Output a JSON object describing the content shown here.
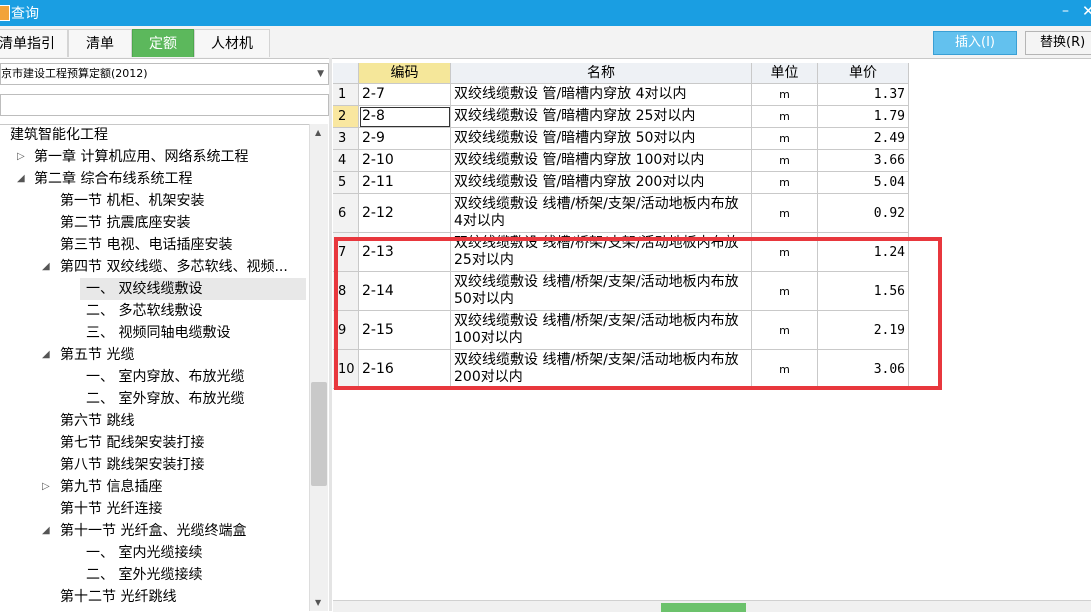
{
  "window": {
    "title": "查询",
    "min_glyph": "–",
    "close_glyph": "✕"
  },
  "tabs": [
    {
      "label": "清单指引"
    },
    {
      "label": "清单"
    },
    {
      "label": "定额"
    },
    {
      "label": "人材机"
    }
  ],
  "active_tab": "定额",
  "buttons": {
    "insert": "插入(I)",
    "replace": "替换(R)"
  },
  "library_select": {
    "value": "京市建设工程预算定额(2012)"
  },
  "search": {
    "value": ""
  },
  "tree": [
    {
      "label": "建筑智能化工程",
      "expander": ""
    },
    {
      "label": "第一章 计算机应用、网络系统工程",
      "expander": "▷"
    },
    {
      "label": "第二章 综合布线系统工程",
      "expander": "◢"
    },
    {
      "label": "第一节 机柜、机架安装",
      "expander": ""
    },
    {
      "label": "第二节 抗震底座安装",
      "expander": ""
    },
    {
      "label": "第三节 电视、电话插座安装",
      "expander": ""
    },
    {
      "label": "第四节 双绞线缆、多芯软线、视频...",
      "expander": "◢"
    },
    {
      "label": "一、 双绞线缆敷设",
      "expander": ""
    },
    {
      "label": "二、 多芯软线敷设",
      "expander": ""
    },
    {
      "label": "三、 视频同轴电缆敷设",
      "expander": ""
    },
    {
      "label": "第五节 光缆",
      "expander": "◢"
    },
    {
      "label": "一、 室内穿放、布放光缆",
      "expander": ""
    },
    {
      "label": "二、 室外穿放、布放光缆",
      "expander": ""
    },
    {
      "label": "第六节 跳线",
      "expander": ""
    },
    {
      "label": "第七节 配线架安装打接",
      "expander": ""
    },
    {
      "label": "第八节 跳线架安装打接",
      "expander": ""
    },
    {
      "label": "第九节 信息插座",
      "expander": "▷"
    },
    {
      "label": "第十节 光纤连接",
      "expander": ""
    },
    {
      "label": "第十一节 光纤盒、光缆终端盒",
      "expander": "◢"
    },
    {
      "label": "一、 室内光缆接续",
      "expander": ""
    },
    {
      "label": "二、 室外光缆接续",
      "expander": ""
    },
    {
      "label": "第十二节 光纤跳线",
      "expander": ""
    }
  ],
  "selected_tree_item": "一、 双绞线缆敷设",
  "table": {
    "headers": {
      "code": "编码",
      "name": "名称",
      "unit": "单位",
      "price": "单价"
    },
    "rows": [
      {
        "n": "1",
        "code": "2-7",
        "name": "双绞线缆敷设 管/暗槽内穿放 4对以内",
        "unit": "m",
        "price": "1.37"
      },
      {
        "n": "2",
        "code": "2-8",
        "name": "双绞线缆敷设 管/暗槽内穿放 25对以内",
        "unit": "m",
        "price": "1.79"
      },
      {
        "n": "3",
        "code": "2-9",
        "name": "双绞线缆敷设 管/暗槽内穿放 50对以内",
        "unit": "m",
        "price": "2.49"
      },
      {
        "n": "4",
        "code": "2-10",
        "name": "双绞线缆敷设 管/暗槽内穿放 100对以内",
        "unit": "m",
        "price": "3.66"
      },
      {
        "n": "5",
        "code": "2-11",
        "name": "双绞线缆敷设 管/暗槽内穿放 200对以内",
        "unit": "m",
        "price": "5.04"
      },
      {
        "n": "6",
        "code": "2-12",
        "name": "双绞线缆敷设 线槽/桥架/支架/活动地板内布放 4对以内",
        "unit": "m",
        "price": "0.92"
      },
      {
        "n": "7",
        "code": "2-13",
        "name": "双绞线缆敷设 线槽/桥架/支架/活动地板内布放 25对以内",
        "unit": "m",
        "price": "1.24"
      },
      {
        "n": "8",
        "code": "2-14",
        "name": "双绞线缆敷设 线槽/桥架/支架/活动地板内布放 50对以内",
        "unit": "m",
        "price": "1.56"
      },
      {
        "n": "9",
        "code": "2-15",
        "name": "双绞线缆敷设 线槽/桥架/支架/活动地板内布放 100对以内",
        "unit": "m",
        "price": "2.19"
      },
      {
        "n": "10",
        "code": "2-16",
        "name": "双绞线缆敷设 线槽/桥架/支架/活动地板内布放 200对以内",
        "unit": "m",
        "price": "3.06"
      }
    ]
  },
  "current_row": "2",
  "colors": {
    "titlebar": "#1a9ee2",
    "active_tab": "#5cb85c",
    "insert_button": "#63c1ee",
    "highlight_box": "#e8373d"
  },
  "icons": {
    "expanded": "triangle-down-icon",
    "collapsed": "triangle-right-icon"
  }
}
